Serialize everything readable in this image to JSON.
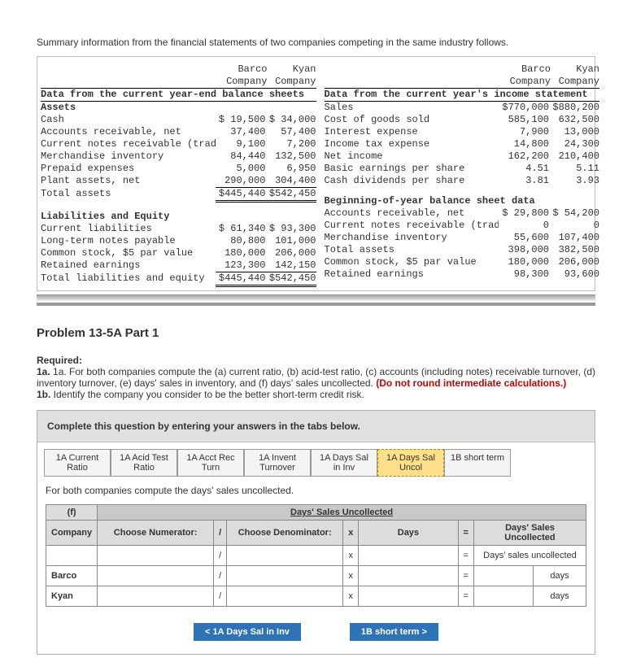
{
  "intro": "Summary information from the financial statements of two companies competing in the same industry follows.",
  "headers": {
    "barco": "Barco",
    "kyan": "Kyan",
    "company": "Company"
  },
  "left_title": "Data from the current year-end balance sheets",
  "right_title": "Data from the current year's income statement",
  "assets_label": "Assets",
  "left_rows": {
    "cash": {
      "l": "Cash",
      "b": "$ 19,500",
      "k": "$ 34,000"
    },
    "ar": {
      "l": "Accounts receivable, net",
      "b": "37,400",
      "k": "57,400"
    },
    "cnr": {
      "l": "Current notes receivable (trade)",
      "b": "9,100",
      "k": "7,200"
    },
    "merch": {
      "l": "Merchandise inventory",
      "b": "84,440",
      "k": "132,500"
    },
    "prepaid": {
      "l": "Prepaid expenses",
      "b": "5,000",
      "k": "6,950"
    },
    "plant": {
      "l": "Plant assets, net",
      "b": "290,000",
      "k": "304,400"
    },
    "ta": {
      "l": "Total assets",
      "b": "$445,440",
      "k": "$542,450"
    }
  },
  "liab_title": "Liabilities and Equity",
  "liab_rows": {
    "cl": {
      "l": "Current liabilities",
      "b": "$ 61,340",
      "k": "$ 93,300"
    },
    "ltnp": {
      "l": "Long-term notes payable",
      "b": "80,800",
      "k": "101,000"
    },
    "cs": {
      "l": "Common stock, $5 par value",
      "b": "180,000",
      "k": "206,000"
    },
    "re": {
      "l": "Retained earnings",
      "b": "123,300",
      "k": "142,150"
    },
    "tle": {
      "l": "Total liabilities and equity",
      "b": "$445,440",
      "k": "$542,450"
    }
  },
  "right_rows": {
    "sales": {
      "l": "Sales",
      "b": "$770,000",
      "k": "$880,200"
    },
    "cogs": {
      "l": "Cost of goods sold",
      "b": "585,100",
      "k": "632,500"
    },
    "int": {
      "l": "Interest expense",
      "b": "7,900",
      "k": "13,000"
    },
    "itx": {
      "l": "Income tax expense",
      "b": "14,800",
      "k": "24,300"
    },
    "ni": {
      "l": "Net income",
      "b": "162,200",
      "k": "210,400"
    },
    "beps": {
      "l": "Basic earnings per share",
      "b": "4.51",
      "k": "5.11"
    },
    "cdps": {
      "l": "Cash dividends per share",
      "b": "3.81",
      "k": "3.93"
    }
  },
  "boy_title": "Beginning-of-year balance sheet data",
  "boy_rows": {
    "ar": {
      "l": "Accounts receivable, net",
      "b": "$ 29,800",
      "k": "$ 54,200"
    },
    "cnr": {
      "l": "Current notes receivable (trade)",
      "b": "0",
      "k": "0"
    },
    "merch": {
      "l": "Merchandise inventory",
      "b": "55,600",
      "k": "107,400"
    },
    "ta": {
      "l": "Total assets",
      "b": "398,000",
      "k": "382,500"
    },
    "cs": {
      "l": "Common stock, $5 par value",
      "b": "180,000",
      "k": "206,000"
    },
    "re": {
      "l": "Retained earnings",
      "b": "98,300",
      "k": "93,600"
    }
  },
  "problem_title": "Problem 13-5A Part 1",
  "required_label": "Required:",
  "req_1a": "1a. For both companies compute the (a) current ratio, (b) acid-test ratio, (c) accounts (including notes) receivable turnover, (d) inventory turnover, (e) days' sales in inventory, and (f) days' sales uncollected. ",
  "req_red": "(Do not round intermediate calculations.)",
  "req_1b": "1b. Identify the company you consider to be the better short-term credit risk.",
  "panel_header": "Complete this question by entering your answers in the tabs below.",
  "tabs": {
    "t1": "1A Current Ratio",
    "t2": "1A Acid Test Ratio",
    "t3": "1A Acct Rec Turn",
    "t4": "1A Invent Turnover",
    "t5": "1A Days Sal in Inv",
    "t6": "1A Days Sal Uncol",
    "t7": "1B short term"
  },
  "tab_instruction": "For both companies compute the days' sales uncollected.",
  "calc": {
    "corner": "(f)",
    "super": "Days' Sales Uncollected",
    "company": "Company",
    "numer": "Choose Numerator:",
    "slash": "/",
    "denom": "Choose Denominator:",
    "x": "x",
    "days": "Days",
    "eq": "=",
    "result": "Days' Sales Uncollected",
    "row_label": "Days' sales uncollected",
    "barco": "Barco",
    "kyan": "Kyan",
    "unit": "days"
  },
  "nav": {
    "prev": "<  1A Days Sal in Inv",
    "next": "1B short term  >"
  }
}
